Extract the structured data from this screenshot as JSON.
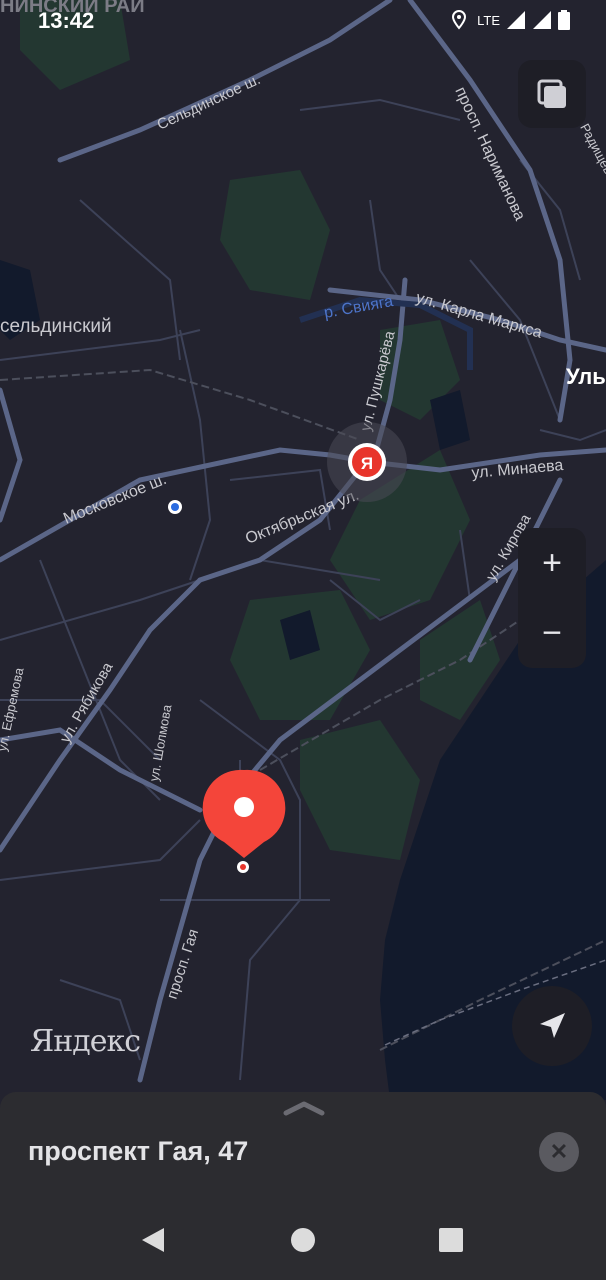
{
  "status_bar": {
    "time": "13:42",
    "network": "LTE"
  },
  "map": {
    "labels": {
      "top_left": "НИНСКИЙ РАЙ",
      "selda_district": "сельдинский",
      "seldinskoe_sh": "Сельдинское ш.",
      "narimanova": "просп. Нариманова",
      "sviyaga": "р. Свияга",
      "karla_marksa": "ул. Карла Маркса",
      "ulyanovsk": "Уль",
      "pushkareva": "ул. Пушкарёва",
      "minaeva": "ул. Минаева",
      "moskovskoe_sh": "Московское ш.",
      "oktyabrskaya": "Октябрьская ул.",
      "kirova": "ул. Кирова",
      "efremova": "ул. Ефремова",
      "rybikova": "ул. Рябикова",
      "sholmova": "ул. Шолмова",
      "gaya": "просп. Гая",
      "radi": "ул. Радищева"
    },
    "yandex_pin_letter": "Я",
    "zoom_in": "+",
    "zoom_out": "−",
    "logo": "Яндекс"
  },
  "sheet": {
    "address": "проспект Гая, 47",
    "close_symbol": "✕"
  }
}
